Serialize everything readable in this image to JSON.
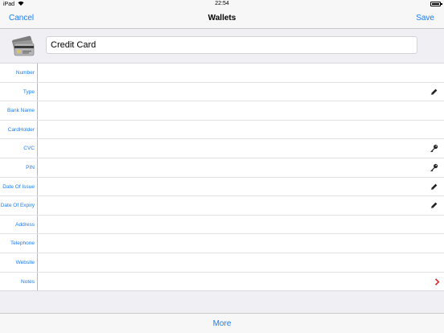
{
  "status_bar": {
    "device": "iPad",
    "time": "22:54"
  },
  "nav_bar": {
    "cancel_label": "Cancel",
    "title": "Wallets",
    "save_label": "Save"
  },
  "header": {
    "name_value": "Credit Card",
    "card_icon": "credit-card-stack-icon"
  },
  "form": {
    "rows": [
      {
        "label": "Number",
        "value": "",
        "action_icon": ""
      },
      {
        "label": "Type",
        "value": "",
        "action_icon": "pencil-icon"
      },
      {
        "label": "Bank Name",
        "value": "",
        "action_icon": ""
      },
      {
        "label": "CardHolder",
        "value": "",
        "action_icon": ""
      },
      {
        "label": "CVC",
        "value": "",
        "action_icon": "key-icon"
      },
      {
        "label": "PIN",
        "value": "",
        "action_icon": "key-icon"
      },
      {
        "label": "Date Of Issue",
        "value": "",
        "action_icon": "pencil-icon"
      },
      {
        "label": "Date Of Expiry",
        "value": "",
        "action_icon": "pencil-icon"
      },
      {
        "label": "Address",
        "value": "",
        "action_icon": ""
      },
      {
        "label": "Telephone",
        "value": "",
        "action_icon": ""
      },
      {
        "label": "Website",
        "value": "",
        "action_icon": ""
      },
      {
        "label": "Notes",
        "value": "",
        "action_icon": "chevron-right-icon"
      }
    ]
  },
  "bottom_bar": {
    "more_label": "More"
  },
  "colors": {
    "accent": "#1a7cf5",
    "chevron": "#e0242a",
    "background": "#efeff4"
  }
}
